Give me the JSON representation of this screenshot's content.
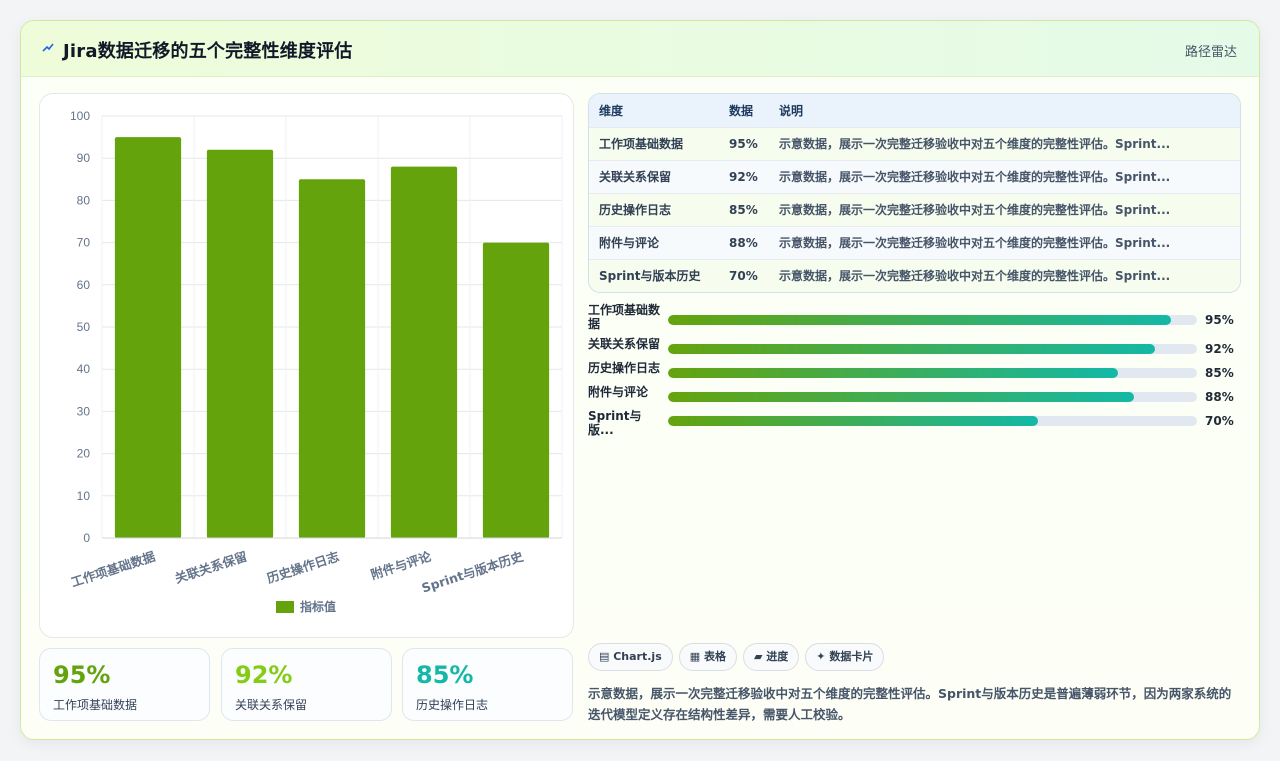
{
  "header": {
    "title": "Jira数据迁移的五个完整性维度评估",
    "radar_label": "路径雷达"
  },
  "colors": {
    "bar": "#65a30d",
    "accent_green": "#65a30d",
    "accent_lime": "#84cc16",
    "accent_teal": "#14b8a6"
  },
  "chart_data": {
    "type": "bar",
    "categories": [
      "工作项基础数据",
      "关联关系保留",
      "历史操作日志",
      "附件与评论",
      "Sprint与版本历史"
    ],
    "series": [
      {
        "name": "指标值",
        "values": [
          95,
          92,
          85,
          88,
          70
        ]
      }
    ],
    "ylim": [
      0,
      100
    ],
    "yticks": [
      0,
      10,
      20,
      30,
      40,
      50,
      60,
      70,
      80,
      90,
      100
    ],
    "grid": true,
    "legend": "bottom",
    "title": "",
    "xlabel": "",
    "ylabel": ""
  },
  "table": {
    "headers": [
      "维度",
      "数据",
      "说明"
    ],
    "rows": [
      {
        "name": "工作项基础数据",
        "value": "95%",
        "desc": "示意数据，展示一次完整迁移验收中对五个维度的完整性评估。Sprint..."
      },
      {
        "name": "关联关系保留",
        "value": "92%",
        "desc": "示意数据，展示一次完整迁移验收中对五个维度的完整性评估。Sprint..."
      },
      {
        "name": "历史操作日志",
        "value": "85%",
        "desc": "示意数据，展示一次完整迁移验收中对五个维度的完整性评估。Sprint..."
      },
      {
        "name": "附件与评论",
        "value": "88%",
        "desc": "示意数据，展示一次完整迁移验收中对五个维度的完整性评估。Sprint..."
      },
      {
        "name": "Sprint与版本历史",
        "value": "70%",
        "desc": "示意数据，展示一次完整迁移验收中对五个维度的完整性评估。Sprint..."
      }
    ]
  },
  "progress": [
    {
      "label": "工作项基础数据",
      "percent": 95,
      "value": "95%"
    },
    {
      "label": "关联关系保留",
      "percent": 92,
      "value": "92%"
    },
    {
      "label": "历史操作日志",
      "percent": 85,
      "value": "85%"
    },
    {
      "label": "附件与评论",
      "percent": 88,
      "value": "88%"
    },
    {
      "label": "Sprint与版...",
      "percent": 70,
      "value": "70%"
    }
  ],
  "stats": [
    {
      "value": "95%",
      "label": "工作项基础数据",
      "color": "#65a30d"
    },
    {
      "value": "92%",
      "label": "关联关系保留",
      "color": "#84cc16"
    },
    {
      "value": "85%",
      "label": "历史操作日志",
      "color": "#14b8a6"
    }
  ],
  "chips": [
    {
      "icon": "chart-icon",
      "label": "Chart.js"
    },
    {
      "icon": "table-icon",
      "label": "表格"
    },
    {
      "icon": "progress-icon",
      "label": "进度"
    },
    {
      "icon": "sparkle-icon",
      "label": "数据卡片"
    }
  ],
  "note": "示意数据，展示一次完整迁移验收中对五个维度的完整性评估。Sprint与版本历史是普遍薄弱环节，因为两家系统的迭代模型定义存在结构性差异，需要人工校验。"
}
